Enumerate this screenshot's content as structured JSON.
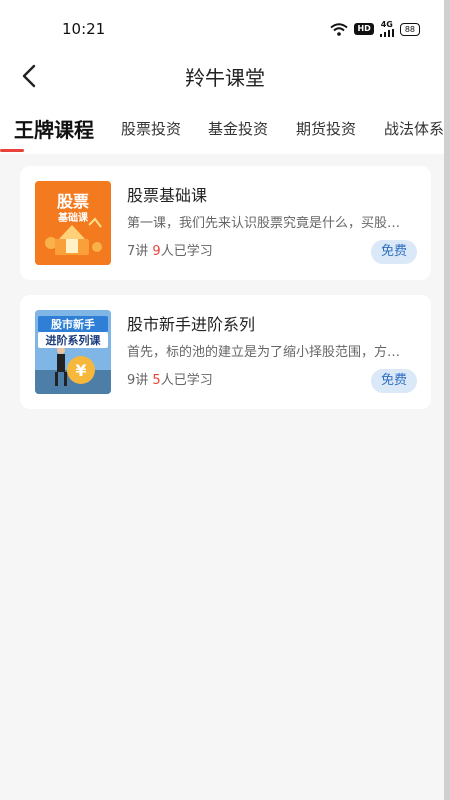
{
  "status": {
    "time": "10:21",
    "hd": "HD",
    "network": "4G",
    "battery": "88"
  },
  "header": {
    "title": "羚牛课堂"
  },
  "tabs": [
    {
      "label": "王牌课程",
      "active": true
    },
    {
      "label": "股票投资"
    },
    {
      "label": "基金投资"
    },
    {
      "label": "期货投资"
    },
    {
      "label": "战法体系"
    }
  ],
  "courses": [
    {
      "title": "股票基础课",
      "desc": "第一课，我们先来认识股票究竟是什么，买股…",
      "lessons": "7讲",
      "learners_num": "9",
      "learners_suffix": "人已学习",
      "badge": "免费",
      "thumb_line1": "股票",
      "thumb_line2": "基础课"
    },
    {
      "title": "股市新手进阶系列",
      "desc": "首先，标的池的建立是为了缩小择股范围，方…",
      "lessons": "9讲",
      "learners_num": "5",
      "learners_suffix": "人已学习",
      "badge": "免费",
      "thumb_line1": "股市新手",
      "thumb_line2": "进阶系列课"
    }
  ],
  "colors": {
    "accent": "#e8433a",
    "badge_bg": "#dbe8f8",
    "badge_text": "#2f6fc0",
    "thumb1_bg": "#f47a1f",
    "thumb2_bg": "#7fb6e6"
  },
  "icons": {
    "back": "chevron-left-icon",
    "wifi": "wifi-icon",
    "signal": "signal-icon"
  }
}
